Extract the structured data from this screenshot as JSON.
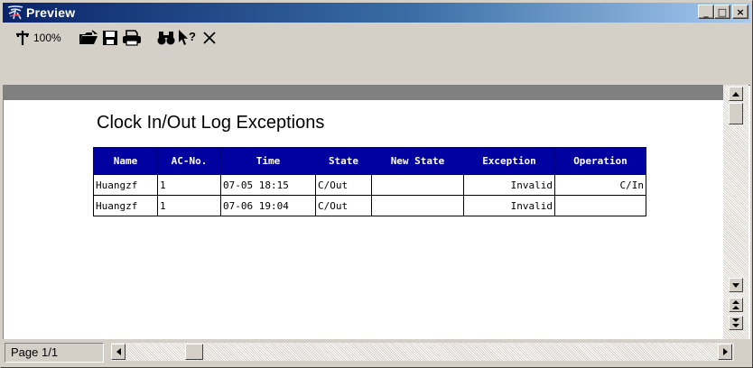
{
  "window": {
    "title": "Preview",
    "caption_buttons": {
      "minimize": "_",
      "maximize": "□",
      "close": "×"
    }
  },
  "toolbar": {
    "zoom_label": "100%",
    "icons": [
      "zoom-pin-icon",
      "open-folder-icon",
      "save-icon",
      "print-icon",
      "find-icon",
      "help-pointer-icon",
      "close-icon"
    ]
  },
  "report": {
    "title": "Clock In/Out Log Exceptions",
    "columns": [
      "Name",
      "AC-No.",
      "Time",
      "State",
      "New State",
      "Exception",
      "Operation"
    ],
    "rows": [
      [
        "Huangzf",
        "1",
        "07-05 18:15",
        "C/Out",
        "",
        "Invalid",
        "C/In"
      ],
      [
        "Huangzf",
        "1",
        "07-06 19:04",
        "C/Out",
        "",
        "Invalid",
        ""
      ]
    ]
  },
  "status": {
    "page_label": "Page 1/1"
  },
  "colors": {
    "title_bar_start": "#0a246a",
    "title_bar_end": "#a6caf0",
    "table_header_bg": "#0000a0",
    "window_face": "#d4d0c8"
  }
}
